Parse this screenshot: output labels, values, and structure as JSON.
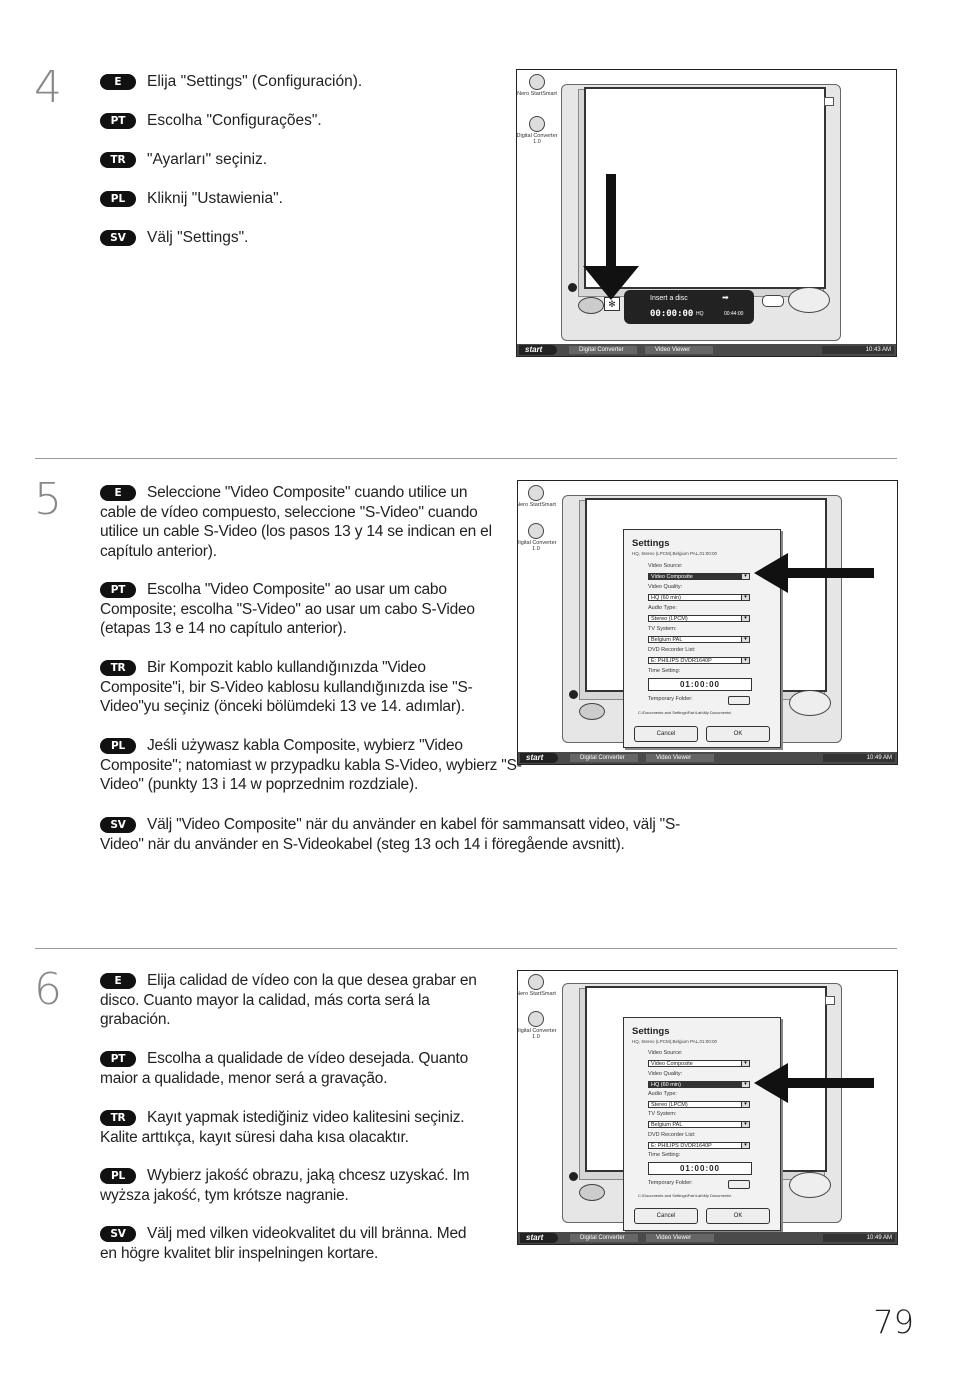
{
  "page_number": "79",
  "steps": [
    {
      "number": "4",
      "instructions": [
        {
          "lang": "E",
          "text": "Elija \"Settings\" (Configuración)."
        },
        {
          "lang": "PT",
          "text": "Escolha \"Configurações\"."
        },
        {
          "lang": "TR",
          "text": "\"Ayarları\" seçiniz."
        },
        {
          "lang": "PL",
          "text": "Kliknij \"Ustawienia\"."
        },
        {
          "lang": "SV",
          "text": "Välj \"Settings\"."
        }
      ]
    },
    {
      "number": "5",
      "instructions": [
        {
          "lang": "E",
          "text": "Seleccione \"Video Composite\" cuando utilice un cable de vídeo compuesto, seleccione \"S-Video\" cuando utilice un cable S-Video (los pasos 13 y 14 se indican en el capítulo anterior)."
        },
        {
          "lang": "PT",
          "text": "Escolha \"Video Composite\" ao usar um cabo Composite; escolha \"S-Video\" ao usar um cabo S-Video (etapas 13 e 14 no capítulo anterior)."
        },
        {
          "lang": "TR",
          "text": "Bir Kompozit kablo kullandığınızda \"Video Composite\"i,  bir S-Video kablosu kullandığınızda ise \"S-Video\"yu seçiniz (önceki bölümdeki 13 ve 14. adımlar)."
        },
        {
          "lang": "PL",
          "text": "Jeśli używasz kabla Composite, wybierz \"Video Composite\"; natomiast w przypadku kabla S-Video, wybierz \"S-Video\" (punkty 13 i 14 w poprzednim rozdziale)."
        },
        {
          "lang": "SV",
          "text": "Välj \"Video Composite\" när du använder en kabel för sammansatt video, välj \"S-Video\" när du använder en S-Videokabel (steg 13 och 14 i föregående avsnitt)."
        }
      ]
    },
    {
      "number": "6",
      "instructions": [
        {
          "lang": "E",
          "text": "Elija calidad de vídeo con la que desea grabar en disco. Cuanto mayor la calidad, más corta será la grabación."
        },
        {
          "lang": "PT",
          "text": "Escolha a qualidade de vídeo desejada. Quanto maior a qualidade, menor será a gravação."
        },
        {
          "lang": "TR",
          "text": "Kayıt yapmak istediğiniz video kalitesini seçiniz. Kalite arttıkça, kayıt süresi daha kısa olacaktır."
        },
        {
          "lang": "PL",
          "text": "Wybierz jakość obrazu, jaką chcesz uzyskać. Im wyższa jakość, tym krótsze nagranie."
        },
        {
          "lang": "SV",
          "text": "Välj med vilken videokvalitet du vill bränna. Med en högre kvalitet blir inspelningen kortare."
        }
      ]
    }
  ],
  "screenshots": {
    "desktop_icons": [
      "Nero StartSmart",
      "Digital Converter 1.0"
    ],
    "taskbar": {
      "start": "start",
      "item1": "Digital Converter",
      "item2": "Video Viewer",
      "time_a": "10:43 AM",
      "time_b": "10:49 AM"
    },
    "app": {
      "status": "Insert a disc",
      "timer": "00:00:00",
      "quality": "HQ",
      "remaining": "00:44:00"
    },
    "settings": {
      "title": "Settings",
      "summary": "HQ, Stereo (LPCM),Belgium PAL,01:00:00",
      "video_source_label": "Video Source:",
      "video_source": "Video Composite",
      "video_quality_label": "Video Quality:",
      "video_quality": "HQ (60 min)",
      "audio_type_label": "Audio Type:",
      "audio_type": "Stereo (LPCM)",
      "tv_system_label": "TV System:",
      "tv_system": "Belgium  PAL",
      "recorder_label": "DVD Recorder List:",
      "recorder": "E: PHILIPS DVDR1640P",
      "time_label": "Time Setting:",
      "time": "01:00:00",
      "temp_label": "Temporary Folder:",
      "temp_path": "C:\\Documents and Settings\\Fair\\Lab\\My Documents\\",
      "cancel": "Cancel",
      "ok": "OK"
    }
  }
}
